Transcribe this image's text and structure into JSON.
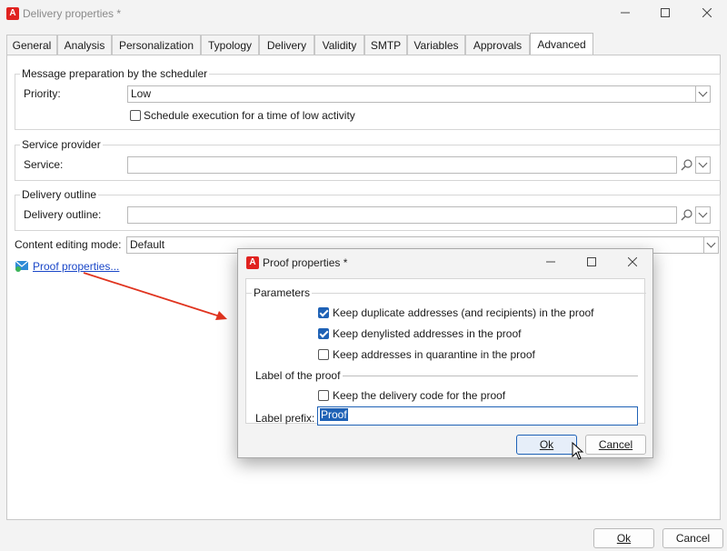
{
  "main_window": {
    "title": "Delivery properties *",
    "tabs": [
      "General",
      "Analysis",
      "Personalization",
      "Typology",
      "Delivery",
      "Validity",
      "SMTP",
      "Variables",
      "Approvals",
      "Advanced"
    ],
    "scheduler_group": {
      "title": "Message preparation by the scheduler",
      "priority_label": "Priority:",
      "priority_value": "Low",
      "low_activity_label": "Schedule execution for a time of low activity"
    },
    "service_group": {
      "title": "Service provider",
      "service_label": "Service:",
      "service_value": ""
    },
    "outline_group": {
      "title": "Delivery outline",
      "outline_label": "Delivery outline:",
      "outline_value": ""
    },
    "content_editing_label": "Content editing mode:",
    "content_editing_value": "Default",
    "proof_link": "Proof properties...",
    "ok_label": "Ok",
    "cancel_label": "Cancel"
  },
  "dialog": {
    "title": "Proof properties *",
    "parameters_title": "Parameters",
    "checkboxes": [
      {
        "label": "Keep duplicate addresses (and recipients) in the proof",
        "checked": true
      },
      {
        "label": "Keep denylisted addresses in the proof",
        "checked": true
      },
      {
        "label": "Keep addresses in quarantine in the proof",
        "checked": false
      }
    ],
    "label_section_title": "Label of the proof",
    "keep_code_label": "Keep the delivery code for the proof",
    "label_prefix_label": "Label prefix:",
    "label_prefix_value": "Proof",
    "ok_label": "Ok",
    "cancel_label": "Cancel"
  },
  "colors": {
    "accent": "#1f62b6",
    "brand_icon": "#e0221f",
    "annotation_arrow": "#e0341f"
  }
}
